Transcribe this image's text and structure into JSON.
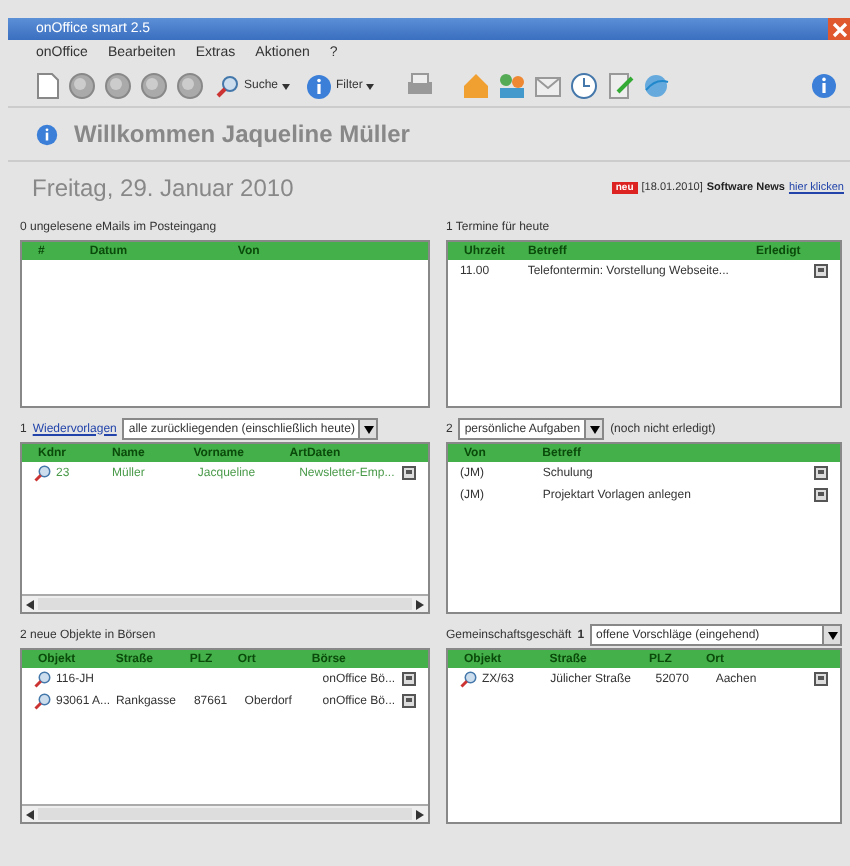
{
  "window": {
    "title": "onOffice smart 2.5"
  },
  "menu": [
    "onOffice",
    "Bearbeiten",
    "Extras",
    "Aktionen",
    "?"
  ],
  "toolbar": {
    "search_label": "Suche",
    "filter_label": "Filter"
  },
  "welcome": "Willkommen Jaqueline Müller",
  "date": "Freitag, 29. Januar 2010",
  "news": {
    "badge": "neu",
    "date": "[18.01.2010]",
    "label": "Software News",
    "link": "hier klicken"
  },
  "panels": [
    {
      "header": [
        {
          "kind": "text",
          "text": "0 ungelesene eMails im Posteingang"
        }
      ],
      "columns": [
        "#",
        "Datum",
        "Von"
      ],
      "hscroll": false
    },
    {
      "header": [
        {
          "kind": "text",
          "text": "1 Termine für heute"
        }
      ],
      "columns": [
        "Uhrzeit",
        "Betreff",
        "Erledigt"
      ],
      "rows": [
        {
          "cells": [
            "11.00",
            "Telefontermin: Vorstellung Webseite..."
          ],
          "lens": false,
          "action": true
        }
      ],
      "hscroll": false
    },
    {
      "header": [
        {
          "kind": "text",
          "text": "1"
        },
        {
          "kind": "link",
          "text": "Wiedervorlagen"
        },
        {
          "kind": "select",
          "text": "alle zurückliegenden (einschließlich heute)"
        }
      ],
      "columns": [
        "Kdnr",
        "Name",
        "Vorname",
        "ArtDaten"
      ],
      "rows": [
        {
          "cells": [
            "23",
            "Müller",
            "Jacqueline",
            "Newsletter-Emp..."
          ],
          "lens": true,
          "action": true,
          "overdue": true
        }
      ],
      "hscroll": true
    },
    {
      "header": [
        {
          "kind": "text",
          "text": "2"
        },
        {
          "kind": "select",
          "text": "persönliche Aufgaben"
        },
        {
          "kind": "text",
          "text": "(noch nicht erledigt)"
        }
      ],
      "columns": [
        "Von",
        "Betreff"
      ],
      "rows": [
        {
          "cells": [
            "(JM)",
            "Schulung"
          ],
          "lens": false,
          "action": true
        },
        {
          "cells": [
            "(JM)",
            "Projektart Vorlagen anlegen"
          ],
          "lens": false,
          "action": true
        }
      ],
      "hscroll": false
    },
    {
      "header": [
        {
          "kind": "text",
          "text": "2 neue Objekte in Börsen"
        }
      ],
      "columns": [
        "Objekt",
        "Straße",
        "PLZ",
        "Ort",
        "Börse"
      ],
      "rows": [
        {
          "cells": [
            "116-JH",
            "",
            "",
            "",
            "onOffice Bö..."
          ],
          "lens": true,
          "action": true
        },
        {
          "cells": [
            "93061 A...",
            "Rankgasse",
            "87661",
            "Oberdorf",
            "onOffice Bö..."
          ],
          "lens": true,
          "action": true
        }
      ],
      "hscroll": true
    },
    {
      "header": [
        {
          "kind": "text",
          "text": "Gemeinschaftsgeschäft"
        },
        {
          "kind": "bold",
          "text": "1"
        },
        {
          "kind": "select",
          "text": "offene Vorschläge (eingehend)"
        }
      ],
      "columns": [
        "Objekt",
        "Straße",
        "PLZ",
        "Ort"
      ],
      "rows": [
        {
          "cells": [
            "ZX/63",
            "Jülicher Straße",
            "52070",
            "Aachen"
          ],
          "lens": true,
          "action": true
        }
      ],
      "hscroll": false
    }
  ]
}
